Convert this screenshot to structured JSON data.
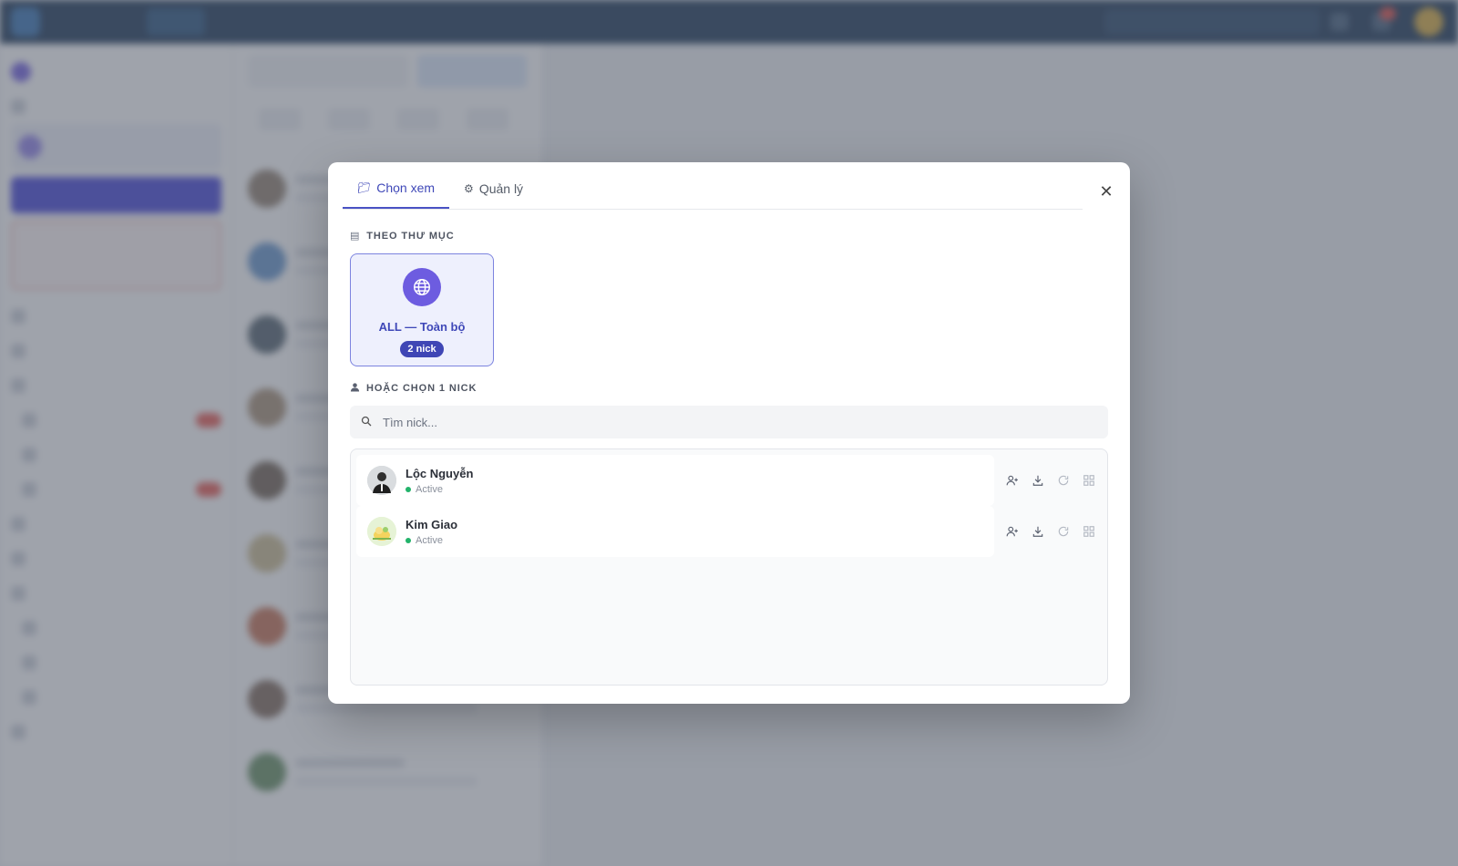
{
  "modal": {
    "tabs": [
      {
        "icon": "folder-icon",
        "label": "Chọn xem"
      },
      {
        "icon": "gear-icon",
        "label": "Quản lý"
      }
    ],
    "close_symbol": "✕",
    "folder_section": {
      "title": "THEO THƯ MỤC"
    },
    "folder_card": {
      "label": "ALL — Toàn bộ",
      "count": "2 nick"
    },
    "nick_section": {
      "title": "HOẶC CHỌN 1 NICK"
    },
    "nick_search": {
      "placeholder": "Tìm nick..."
    },
    "nicks": [
      {
        "name": "Lộc Nguyễn",
        "status": "Active"
      },
      {
        "name": "Kim Giao",
        "status": "Active"
      }
    ]
  },
  "colors": {
    "accent": "#3f48b8",
    "status_active": "#22b36a",
    "overlay": "#5a606e"
  }
}
